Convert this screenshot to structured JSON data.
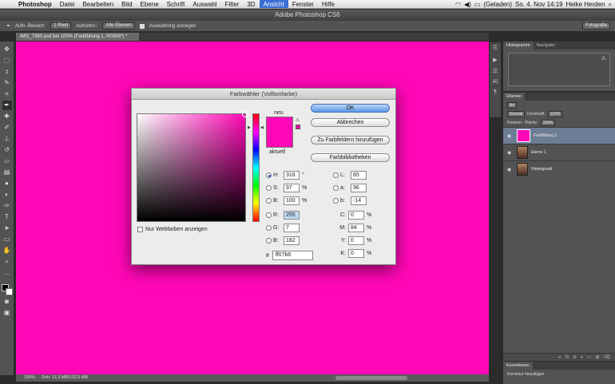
{
  "menubar": {
    "app": "Photoshop",
    "items": [
      "Datei",
      "Bearbeiten",
      "Bild",
      "Ebene",
      "Schrift",
      "Auswahl",
      "Filter",
      "3D",
      "Ansicht",
      "Fenster",
      "Hilfe"
    ],
    "active_item": "Ansicht",
    "battery": "(Geladen)",
    "clock": "So. 4. Nov 14:19",
    "user": "Heike Herden"
  },
  "window_title": "Adobe Photoshop CS6",
  "options_bar": {
    "sample_size_label": "Aufn.-Bereich:",
    "sample_size_value": "1 Pixel",
    "sample_label": "Aufnehm.:",
    "sample_value": "Alle Ebenen",
    "show_ring_label": "Auswahlring anzeigen",
    "workspace": "Fotografie"
  },
  "document_tab": "IMG_7380.psd bei 100% (Farbfüllung 1, RGB/8*) *",
  "status_bar": {
    "zoom": "100%",
    "doc_info": "Dok: 11,3 MB/102,5 MB"
  },
  "panels": {
    "histogram_tabs": [
      "Histogramm",
      "Navigator"
    ],
    "layers_tab": "Ebenen",
    "kind_label": "Art",
    "blend_mode": "Normal",
    "opacity_label": "Deckkraft:",
    "opacity_value": "100%",
    "lock_label": "Fixieren:",
    "fill_label": "Fläche:",
    "fill_value": "100%",
    "layers": [
      "Farbfüllung 1",
      "Ebene 1",
      "Hintergrund"
    ],
    "corrections_tab": "Korrekturen",
    "corrections_hint": "Korrektur hinzufügen"
  },
  "dialog": {
    "title": "Farbwähler (Volltonfarbe)",
    "new_label": "neu",
    "current_label": "aktuell",
    "ok": "OK",
    "cancel": "Abbrechen",
    "add_swatch": "Zu Farbfeldern hinzufügen",
    "libraries": "Farbbibliotheken",
    "web_colors_only": "Nur Webfarben anzeigen",
    "hsb": {
      "H": "318",
      "S": "97",
      "B": "100",
      "H_unit": "°",
      "S_unit": "%",
      "B_unit": "%"
    },
    "rgb": {
      "R": "255",
      "G": "7",
      "B": "182"
    },
    "lab": {
      "L": "65",
      "a": "96",
      "b": "-14"
    },
    "cmyk": {
      "C": "0",
      "M": "84",
      "Y": "0",
      "K": "0",
      "unit": "%"
    },
    "hex_label": "#",
    "hex": "ff07b6",
    "selected_color": "#ff07b6"
  },
  "colors": {
    "canvas": "#ff07b6",
    "accent": "#3b6fd6"
  },
  "icons": [
    "apple-icon",
    "eyedropper-icon",
    "move-icon",
    "marquee-icon",
    "lasso-icon",
    "quick-select-icon",
    "crop-icon",
    "brush-icon",
    "stamp-icon",
    "eraser-icon",
    "gradient-icon",
    "pen-icon",
    "text-icon",
    "hand-icon",
    "zoom-icon",
    "eye-icon",
    "warning-icon"
  ]
}
